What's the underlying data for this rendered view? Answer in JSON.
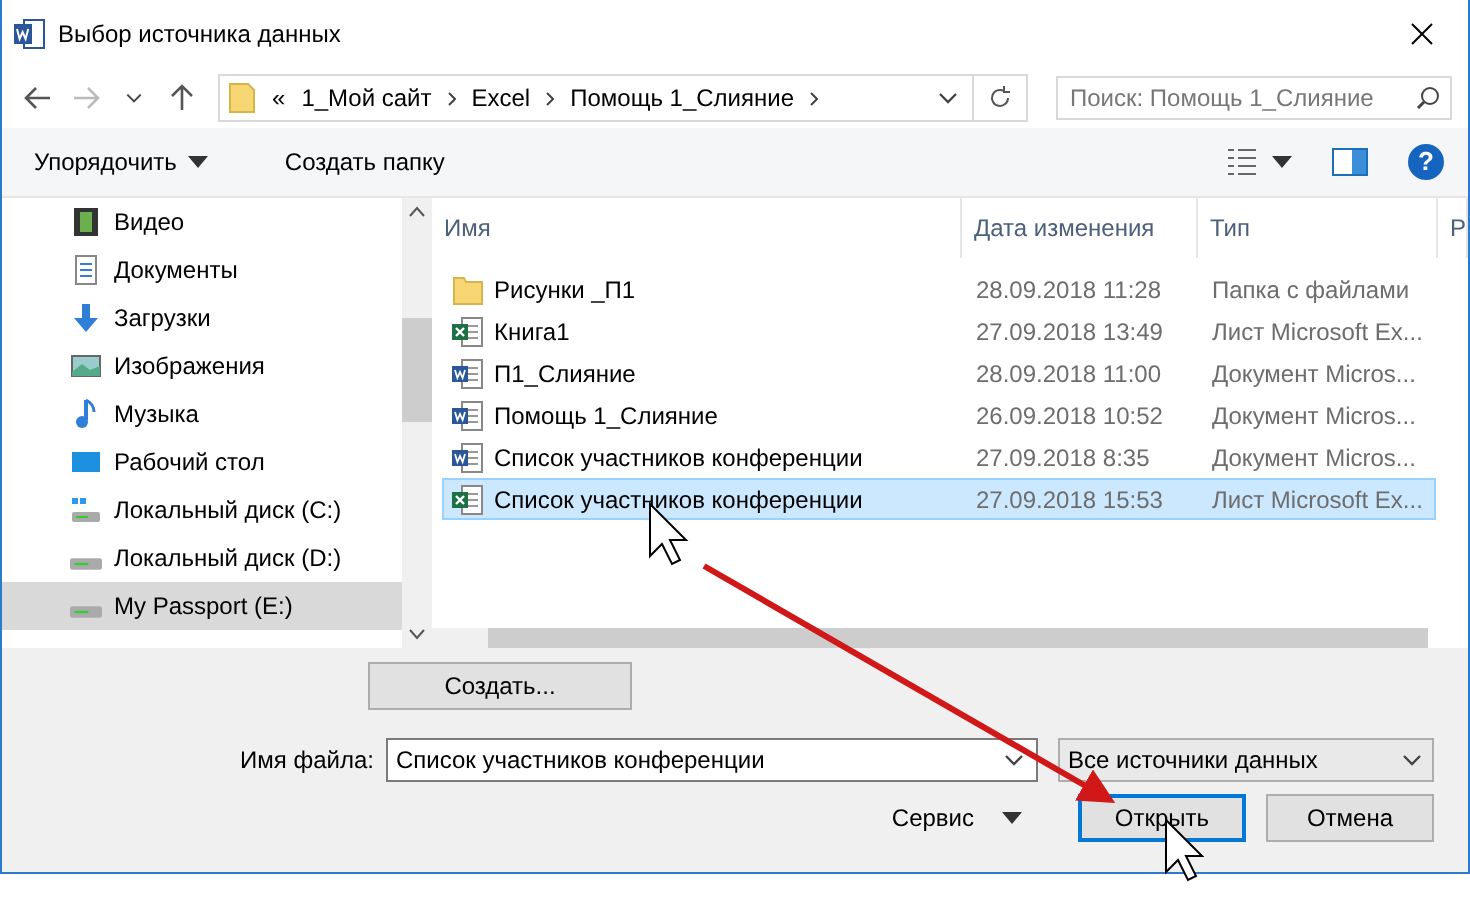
{
  "window": {
    "title": "Выбор источника данных"
  },
  "address": {
    "crumbs": [
      "«",
      "1_Мой сайт",
      "Excel",
      "Помощь 1_Слияние"
    ]
  },
  "search": {
    "placeholder": "Поиск: Помощь 1_Слияние"
  },
  "toolbar": {
    "organize": "Упорядочить",
    "new_folder": "Создать папку",
    "help": "?"
  },
  "sidebar": {
    "items": [
      {
        "label": "Видео",
        "kind": "video",
        "selected": false
      },
      {
        "label": "Документы",
        "kind": "docs",
        "selected": false
      },
      {
        "label": "Загрузки",
        "kind": "download",
        "selected": false
      },
      {
        "label": "Изображения",
        "kind": "pictures",
        "selected": false
      },
      {
        "label": "Музыка",
        "kind": "music",
        "selected": false
      },
      {
        "label": "Рабочий стол",
        "kind": "desktop",
        "selected": false
      },
      {
        "label": "Локальный диск (C:)",
        "kind": "sysdrive",
        "selected": false
      },
      {
        "label": "Локальный диск (D:)",
        "kind": "drive",
        "selected": false
      },
      {
        "label": "My Passport (E:)",
        "kind": "drive",
        "selected": true
      }
    ]
  },
  "table": {
    "columns": [
      "Имя",
      "Дата изменения",
      "Тип",
      "Р"
    ],
    "rows": [
      {
        "kind": "folder",
        "name": "Рисунки _П1",
        "date": "28.09.2018 11:28",
        "type": "Папка с файлами",
        "selected": false
      },
      {
        "kind": "excel",
        "name": "Книга1",
        "date": "27.09.2018 13:49",
        "type": "Лист Microsoft Ex...",
        "selected": false
      },
      {
        "kind": "word",
        "name": "П1_Слияние",
        "date": "28.09.2018 11:00",
        "type": "Документ Micros...",
        "selected": false
      },
      {
        "kind": "word",
        "name": "Помощь 1_Слияние",
        "date": "26.09.2018 10:52",
        "type": "Документ Micros...",
        "selected": false
      },
      {
        "kind": "word",
        "name": "Список участников конференции",
        "date": "27.09.2018 8:35",
        "type": "Документ Micros...",
        "selected": false
      },
      {
        "kind": "excel",
        "name": "Список участников конференции",
        "date": "27.09.2018 15:53",
        "type": "Лист Microsoft Ex...",
        "selected": true
      }
    ]
  },
  "create_button": "Создать...",
  "filename": {
    "label": "Имя файла:",
    "value": "Список участников конференции"
  },
  "filetype": {
    "value": "Все источники данных"
  },
  "tools": "Сервис",
  "buttons": [
    {
      "label": "Открыть",
      "default": true
    },
    {
      "label": "Отмена",
      "default": false
    }
  ]
}
